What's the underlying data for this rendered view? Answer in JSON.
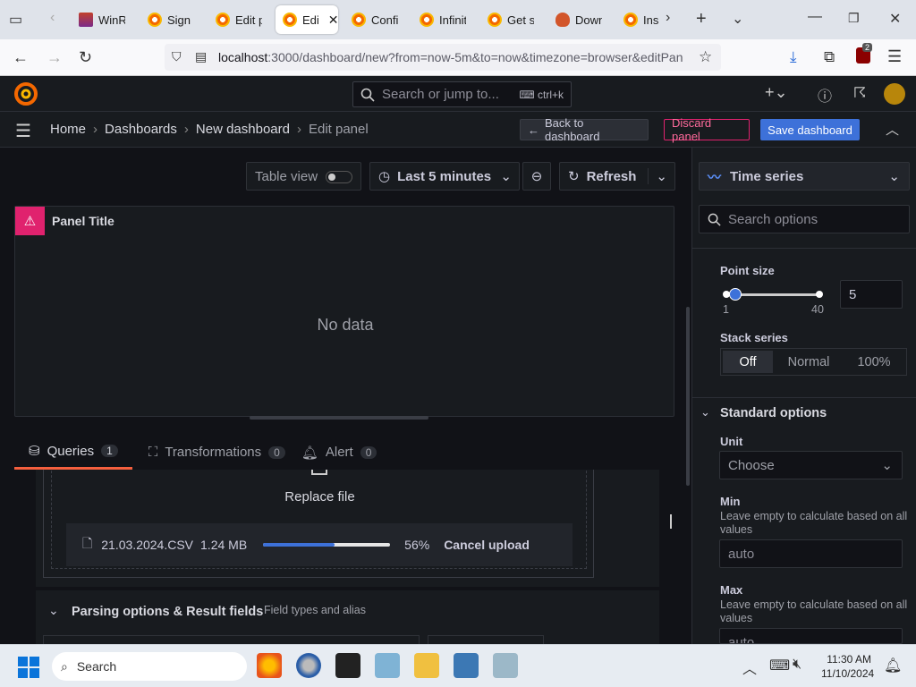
{
  "browser": {
    "tabs": [
      {
        "label": "WinR",
        "icon": "winrar-icon"
      },
      {
        "label": "Sign i",
        "icon": "grafana-icon"
      },
      {
        "label": "Edit p",
        "icon": "grafana-icon"
      },
      {
        "label": "Edi",
        "icon": "grafana-icon",
        "active": true
      },
      {
        "label": "Confi",
        "icon": "grafana-icon"
      },
      {
        "label": "Infinit",
        "icon": "grafana-icon"
      },
      {
        "label": "Get st",
        "icon": "grafana-icon"
      },
      {
        "label": "Down",
        "icon": "download-icon"
      },
      {
        "label": "Ins",
        "icon": "grafana-icon"
      }
    ],
    "url_host": "localhost",
    "url_rest": ":3000/dashboard/new?from=now-5m&to=now&timezone=browser&editPan",
    "extension_badge": "2"
  },
  "grafana": {
    "search_placeholder": "Search or jump to...",
    "search_shortcut": "ctrl+k",
    "breadcrumb": [
      "Home",
      "Dashboards",
      "New dashboard",
      "Edit panel"
    ],
    "back_label": "Back to dashboard",
    "discard_label": "Discard panel",
    "save_label": "Save dashboard"
  },
  "toolbar": {
    "table_view": "Table view",
    "time_range": "Last 5 minutes",
    "refresh": "Refresh"
  },
  "panel": {
    "title": "Panel Title",
    "empty": "No data"
  },
  "query_tabs": [
    {
      "label": "Queries",
      "count": "1",
      "active": true
    },
    {
      "label": "Transformations",
      "count": "0"
    },
    {
      "label": "Alert",
      "count": "0"
    }
  ],
  "upload": {
    "replace": "Replace file",
    "filename": "21.03.2024.CSV",
    "size": "1.24 MB",
    "progress_percent": 56,
    "progress_label": "56%",
    "cancel": "Cancel upload"
  },
  "parsing": {
    "title": "Parsing options & Result fields",
    "subtitle": "Field types and alias"
  },
  "options": {
    "viz": "Time series",
    "search_placeholder": "Search options",
    "point_size_label": "Point size",
    "point_size_min": "1",
    "point_size_max": "40",
    "point_size_value": "5",
    "stack_label": "Stack series",
    "stack_options": [
      "Off",
      "Normal",
      "100%"
    ],
    "stack_selected": "Off",
    "standard_title": "Standard options",
    "unit_label": "Unit",
    "unit_value": "Choose",
    "min_label": "Min",
    "min_desc": "Leave empty to calculate based on all values",
    "min_placeholder": "auto",
    "max_label": "Max",
    "max_desc": "Leave empty to calculate based on all values",
    "max_placeholder": "auto"
  },
  "taskbar": {
    "search": "Search",
    "time": "11:30 AM",
    "date": "11/10/2024"
  },
  "colors": {
    "accent_blue": "#3d71d9",
    "discard_red": "#e0226e",
    "active_tab_orange": "#f55f3e"
  }
}
